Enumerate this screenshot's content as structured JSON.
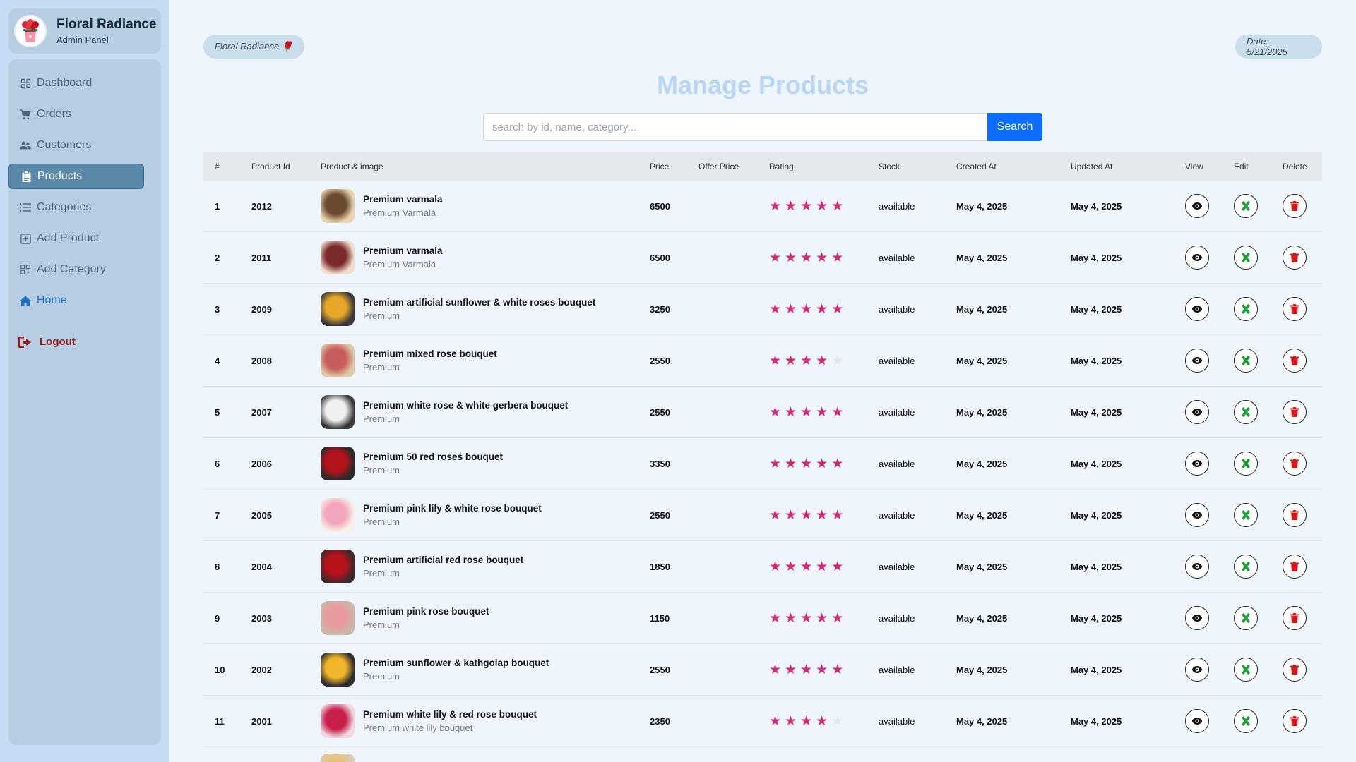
{
  "brand": {
    "name": "Floral Radiance",
    "subtitle": "Admin Panel"
  },
  "nav": [
    {
      "label": "Dashboard",
      "icon": "grid-icon"
    },
    {
      "label": "Orders",
      "icon": "cart-icon"
    },
    {
      "label": "Customers",
      "icon": "users-icon"
    },
    {
      "label": "Products",
      "icon": "clipboard-icon",
      "active": true
    },
    {
      "label": "Categories",
      "icon": "list-icon"
    },
    {
      "label": "Add Product",
      "icon": "plus-square-icon"
    },
    {
      "label": "Add Category",
      "icon": "grid-plus-icon"
    },
    {
      "label": "Home",
      "icon": "home-icon"
    }
  ],
  "logout": {
    "label": "Logout"
  },
  "header": {
    "brand_pill": "Floral Radiance 🌹",
    "date": "Date: 5/21/2025",
    "title": "Manage Products"
  },
  "search": {
    "placeholder": "search by id, name, category...",
    "button": "Search"
  },
  "table": {
    "headers": [
      "#",
      "Product Id",
      "Product & image",
      "Price",
      "Offer Price",
      "Rating",
      "Stock",
      "Created At",
      "Updated At",
      "View",
      "Edit",
      "Delete"
    ],
    "rows": [
      {
        "num": "1",
        "id": "2012",
        "name": "Premium varmala",
        "category": "Premium Varmala",
        "price": "6500",
        "offer": "",
        "rating": 5,
        "stock": "available",
        "created": "May 4, 2025",
        "updated": "May 4, 2025"
      },
      {
        "num": "2",
        "id": "2011",
        "name": "Premium varmala",
        "category": "Premium Varmala",
        "price": "6500",
        "offer": "",
        "rating": 5,
        "stock": "available",
        "created": "May 4, 2025",
        "updated": "May 4, 2025"
      },
      {
        "num": "3",
        "id": "2009",
        "name": "Premium artificial sunflower & white roses bouquet",
        "category": "Premium",
        "price": "3250",
        "offer": "",
        "rating": 5,
        "stock": "available",
        "created": "May 4, 2025",
        "updated": "May 4, 2025"
      },
      {
        "num": "4",
        "id": "2008",
        "name": "Premium mixed rose bouquet",
        "category": "Premium",
        "price": "2550",
        "offer": "",
        "rating": 4,
        "stock": "available",
        "created": "May 4, 2025",
        "updated": "May 4, 2025"
      },
      {
        "num": "5",
        "id": "2007",
        "name": "Premium white rose & white gerbera bouquet",
        "category": "Premium",
        "price": "2550",
        "offer": "",
        "rating": 5,
        "stock": "available",
        "created": "May 4, 2025",
        "updated": "May 4, 2025"
      },
      {
        "num": "6",
        "id": "2006",
        "name": "Premium 50 red roses bouquet",
        "category": "Premium",
        "price": "3350",
        "offer": "",
        "rating": 5,
        "stock": "available",
        "created": "May 4, 2025",
        "updated": "May 4, 2025"
      },
      {
        "num": "7",
        "id": "2005",
        "name": "Premium pink lily & white rose bouquet",
        "category": "Premium",
        "price": "2550",
        "offer": "",
        "rating": 5,
        "stock": "available",
        "created": "May 4, 2025",
        "updated": "May 4, 2025"
      },
      {
        "num": "8",
        "id": "2004",
        "name": "Premium artificial red rose bouquet",
        "category": "Premium",
        "price": "1850",
        "offer": "",
        "rating": 5,
        "stock": "available",
        "created": "May 4, 2025",
        "updated": "May 4, 2025"
      },
      {
        "num": "9",
        "id": "2003",
        "name": "Premium pink rose bouquet",
        "category": "Premium",
        "price": "1150",
        "offer": "",
        "rating": 5,
        "stock": "available",
        "created": "May 4, 2025",
        "updated": "May 4, 2025"
      },
      {
        "num": "10",
        "id": "2002",
        "name": "Premium sunflower & kathgolap bouquet",
        "category": "Premium",
        "price": "2550",
        "offer": "",
        "rating": 5,
        "stock": "available",
        "created": "May 4, 2025",
        "updated": "May 4, 2025"
      },
      {
        "num": "11",
        "id": "2001",
        "name": "Premium white lily & red rose bouquet",
        "category": "Premium white lily bouquet",
        "price": "2350",
        "offer": "",
        "rating": 4,
        "stock": "available",
        "created": "May 4, 2025",
        "updated": "May 4, 2025"
      }
    ]
  },
  "colors": {
    "accent": "#0d6efd",
    "star": "#d6267a",
    "edit": "#1e9e3a",
    "delete": "#d11a1a",
    "logout": "#9c1b1b"
  }
}
